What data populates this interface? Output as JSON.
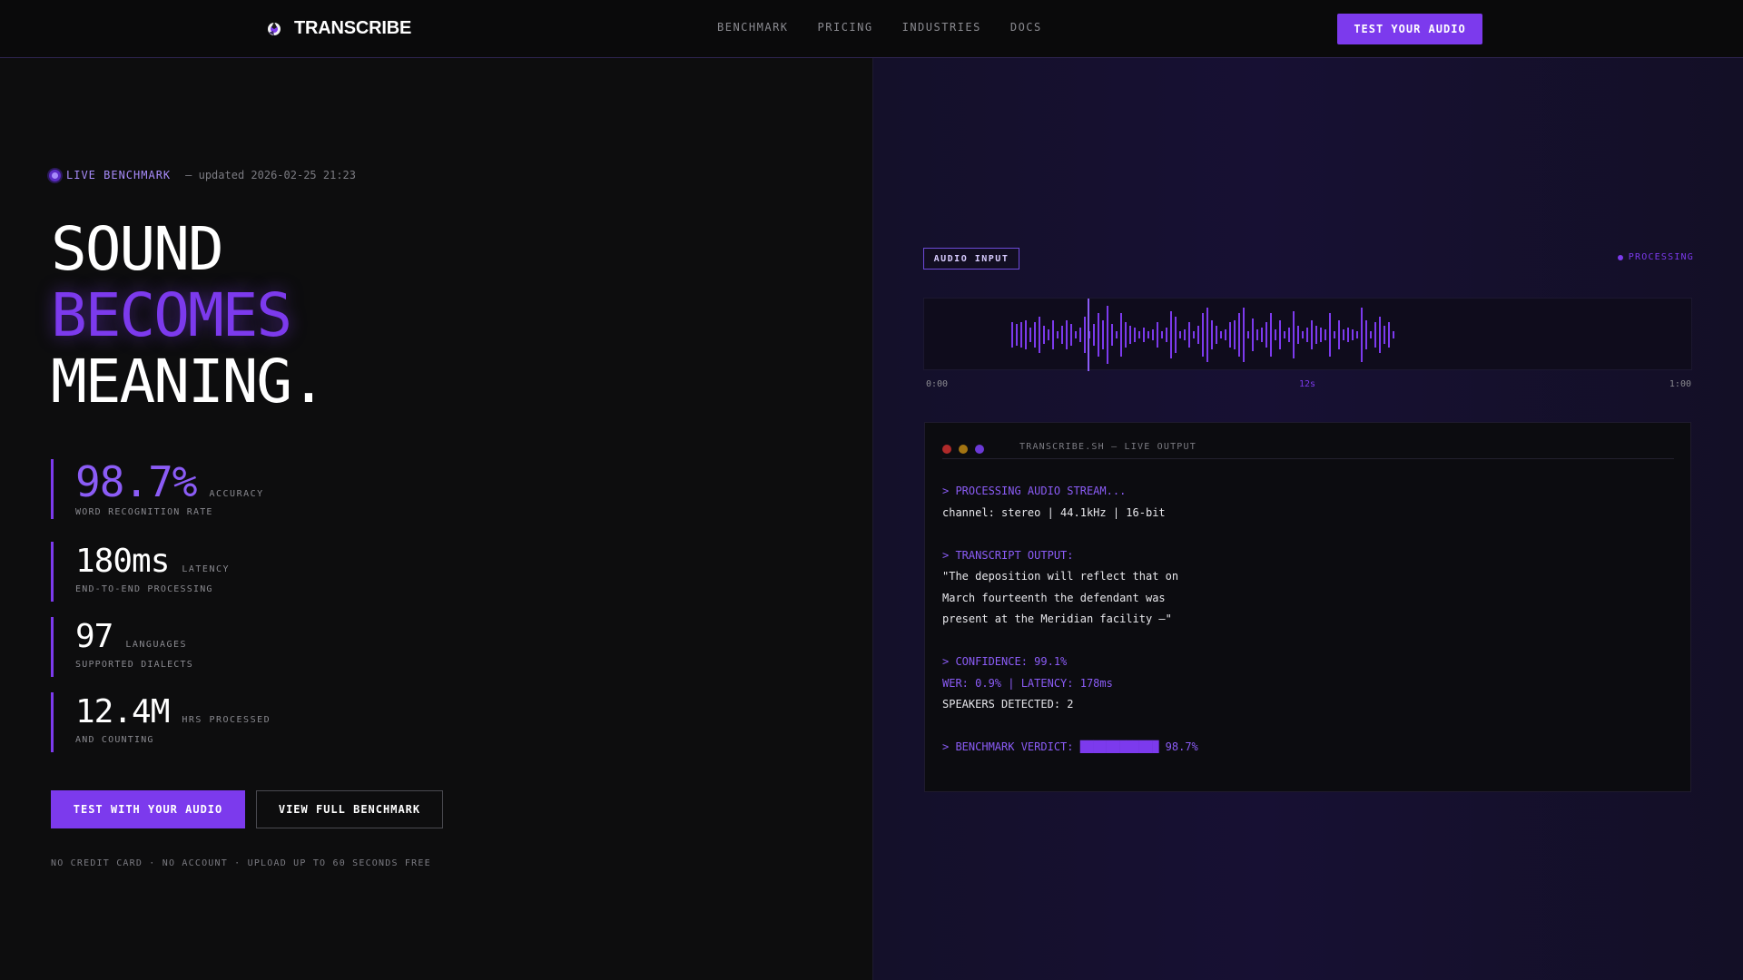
{
  "nav": {
    "brand": "TRANSCRIBE",
    "links": [
      "BENCHMARK",
      "PRICING",
      "INDUSTRIES",
      "DOCS"
    ],
    "cta": "TEST YOUR AUDIO"
  },
  "hero": {
    "live_label": "LIVE BENCHMARK",
    "updated": "— updated 2026-02-25 21:23",
    "headline": [
      "SOUND",
      "BECOMES",
      "MEANING."
    ],
    "stats": [
      {
        "value": "98.7%",
        "unit": "ACCURACY",
        "sub": "WORD RECOGNITION RATE"
      },
      {
        "value": "180ms",
        "unit": "LATENCY",
        "sub": "END-TO-END PROCESSING"
      },
      {
        "value": "97",
        "unit": "LANGUAGES",
        "sub": "SUPPORTED DIALECTS"
      },
      {
        "value": "12.4M",
        "unit": "HRS PROCESSED",
        "sub": "AND COUNTING"
      }
    ],
    "primary_button": "TEST WITH YOUR AUDIO",
    "secondary_button": "VIEW FULL BENCHMARK",
    "fineprint": "NO CREDIT CARD · NO ACCOUNT · UPLOAD UP TO 60 SECONDS FREE"
  },
  "audio": {
    "badge": "AUDIO INPUT",
    "status": "PROCESSING",
    "time_start": "0:00",
    "time_mid": "12s",
    "time_end": "1:00",
    "colors": {
      "accent": "#7c3aed",
      "wave": "#7c3aed"
    }
  },
  "terminal": {
    "title": "TRANSCRIBE.SH — LIVE OUTPUT",
    "lines": [
      {
        "style": "prompt",
        "text": "> PROCESSING AUDIO STREAM..."
      },
      {
        "style": "plain",
        "text": "channel: stereo | 44.1kHz | 16-bit"
      },
      {
        "style": "plain",
        "text": ""
      },
      {
        "style": "prompt",
        "text": "> TRANSCRIPT OUTPUT:"
      },
      {
        "style": "plain",
        "text": "\"The deposition will reflect that on"
      },
      {
        "style": "plain",
        "text": "March fourteenth the defendant was"
      },
      {
        "style": "plain",
        "text": "present at the Meridian facility —\""
      },
      {
        "style": "plain",
        "text": ""
      },
      {
        "style": "prompt",
        "text": "> CONFIDENCE: 99.1%"
      },
      {
        "style": "accent",
        "text": "WER: 0.9% | LATENCY: 178ms"
      },
      {
        "style": "plain",
        "text": "SPEAKERS DETECTED: 2"
      },
      {
        "style": "plain",
        "text": ""
      }
    ],
    "verdict_label": "> BENCHMARK VERDICT: ",
    "verdict_bar": "████████████",
    "verdict_value": " 98.7%"
  }
}
